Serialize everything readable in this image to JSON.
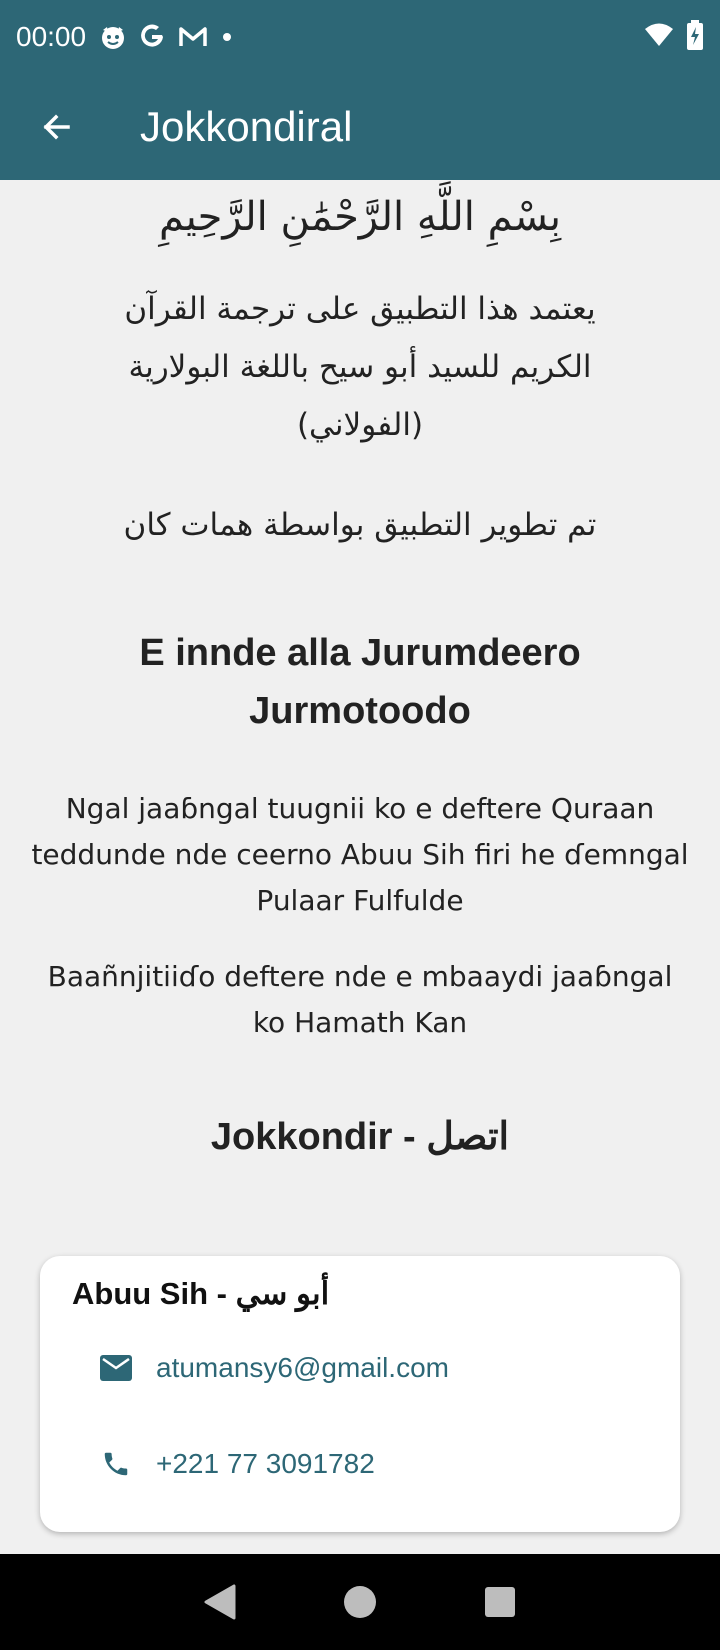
{
  "status_bar": {
    "time": "00:00",
    "icons": [
      "cat-face-icon",
      "google-g-icon",
      "gmail-icon",
      "dot-icon"
    ],
    "right_icons": [
      "wifi-icon",
      "battery-charging-icon"
    ]
  },
  "app_bar": {
    "title": "Jokkondiral",
    "back_icon": "arrow-back-icon"
  },
  "content": {
    "bismillah": "بِسْمِ اللَّهِ الرَّحْمَٰنِ الرَّحِيمِ",
    "arabic_description": "يعتمد هذا التطبيق على ترجمة القرآن الكريم للسيد أبو سيح باللغة البولارية (الفولاني)",
    "arabic_developer": "تم تطوير التطبيق بواسطة همات كان",
    "heading": "E innde alla Jurumdeero Jurmotoodo",
    "fulfulde_description": "Ngal jaaɓngal tuugnii ko e deftere Quraan teddunde nde ceerno Abuu Sih firi he ɗemngal Pulaar Fulfulde",
    "fulfulde_developer": "Baañnjitiiɗo deftere nde e mbaaydi jaaɓngal ko Hamath Kan",
    "contact_heading": "Jokkondir - اتصل"
  },
  "contact_card": {
    "name": "Abuu Sih - أبو سي",
    "email": "atumansy6@gmail.com",
    "phone": "+221 77 3091782",
    "email_icon": "email-icon",
    "phone_icon": "phone-icon"
  },
  "nav_bar": {
    "buttons": [
      "back-triangle-icon",
      "home-circle-icon",
      "recents-square-icon"
    ]
  },
  "colors": {
    "primary": "#2d6776",
    "background": "#f0f0f0",
    "card": "#ffffff",
    "nav": "#000000"
  }
}
